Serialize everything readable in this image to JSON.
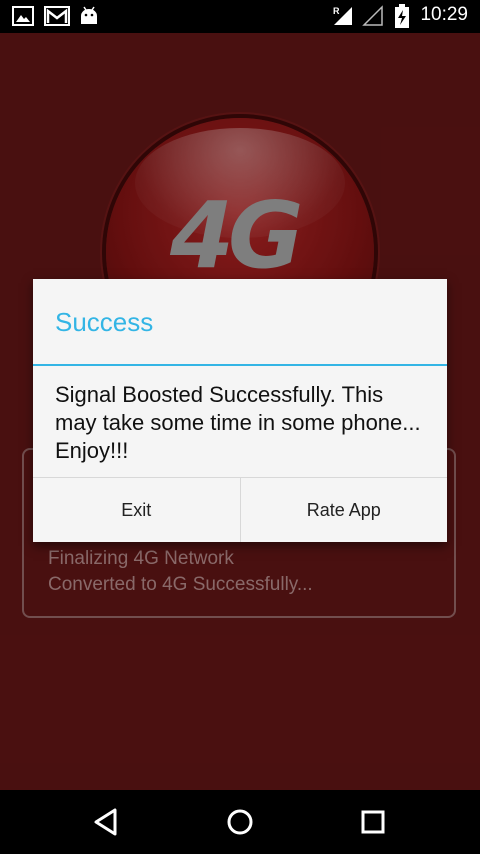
{
  "status_bar": {
    "time": "10:29",
    "notification_icons": [
      "image-icon",
      "gmail-icon",
      "android-icon"
    ],
    "system_icons": [
      "signal-roaming-icon",
      "signal-empty-icon",
      "battery-charging-icon"
    ]
  },
  "app": {
    "logo_text": "4G",
    "log_lines": [
      "Finalizing 4G Network",
      "Converted to 4G Successfully..."
    ]
  },
  "dialog": {
    "title": "Success",
    "message": "Signal Boosted Successfully. This may take some time in some phone... Enjoy!!!",
    "buttons": {
      "exit": "Exit",
      "rate": "Rate App"
    },
    "accent_color": "#33b5e5"
  },
  "nav_bar": {
    "buttons": [
      "back-icon",
      "home-icon",
      "recents-icon"
    ]
  },
  "colors": {
    "app_background": "#5a1414",
    "dialog_background": "#f5f5f5"
  }
}
